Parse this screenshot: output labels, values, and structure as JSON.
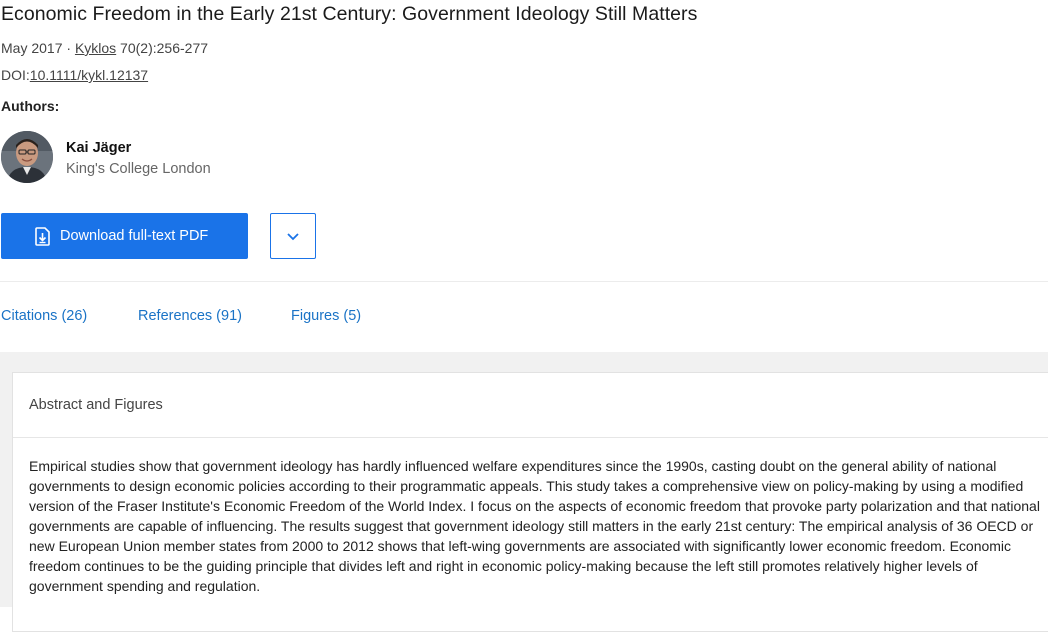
{
  "paper": {
    "title": "Economic Freedom in the Early 21st Century: Government Ideology Still Matters",
    "date": "May 2017 · ",
    "journal": "Kyklos",
    "issue": " 70(2):256-277",
    "doi_prefix": "DOI:",
    "doi": "10.1111/kykl.12137"
  },
  "authors": {
    "label": "Authors:",
    "list": [
      {
        "name": "Kai Jäger",
        "affiliation": "King's College London"
      }
    ]
  },
  "actions": {
    "download_label": "Download full-text PDF"
  },
  "tabs": [
    {
      "label": "Citations (26)"
    },
    {
      "label": "References (91)"
    },
    {
      "label": "Figures (5)"
    }
  ],
  "abstract": {
    "header": "Abstract and Figures",
    "text": "Empirical studies show that government ideology has hardly influenced welfare expenditures since the 1990s, casting doubt on the general ability of national governments to design economic policies according to their programmatic appeals. This study takes a comprehensive view on policy-making by using a modified version of the Fraser Institute's Economic Freedom of the World Index. I focus on the aspects of economic freedom that provoke party polarization and that national governments are capable of influencing. The results suggest that government ideology still matters in the early 21st century: The empirical analysis of 36 OECD or new European Union member states from 2000 to 2012 shows that left-wing governments are associated with significantly lower economic freedom. Economic freedom continues to be the guiding principle that divides left and right in economic policy-making because the left still promotes relatively higher levels of government spending and regulation."
  },
  "colors": {
    "accent": "#1a73e8",
    "link": "#1a73c6",
    "background_grey": "#f1f1f1"
  },
  "icons": {
    "download": "file-download-icon",
    "dropdown": "chevron-down-icon"
  }
}
